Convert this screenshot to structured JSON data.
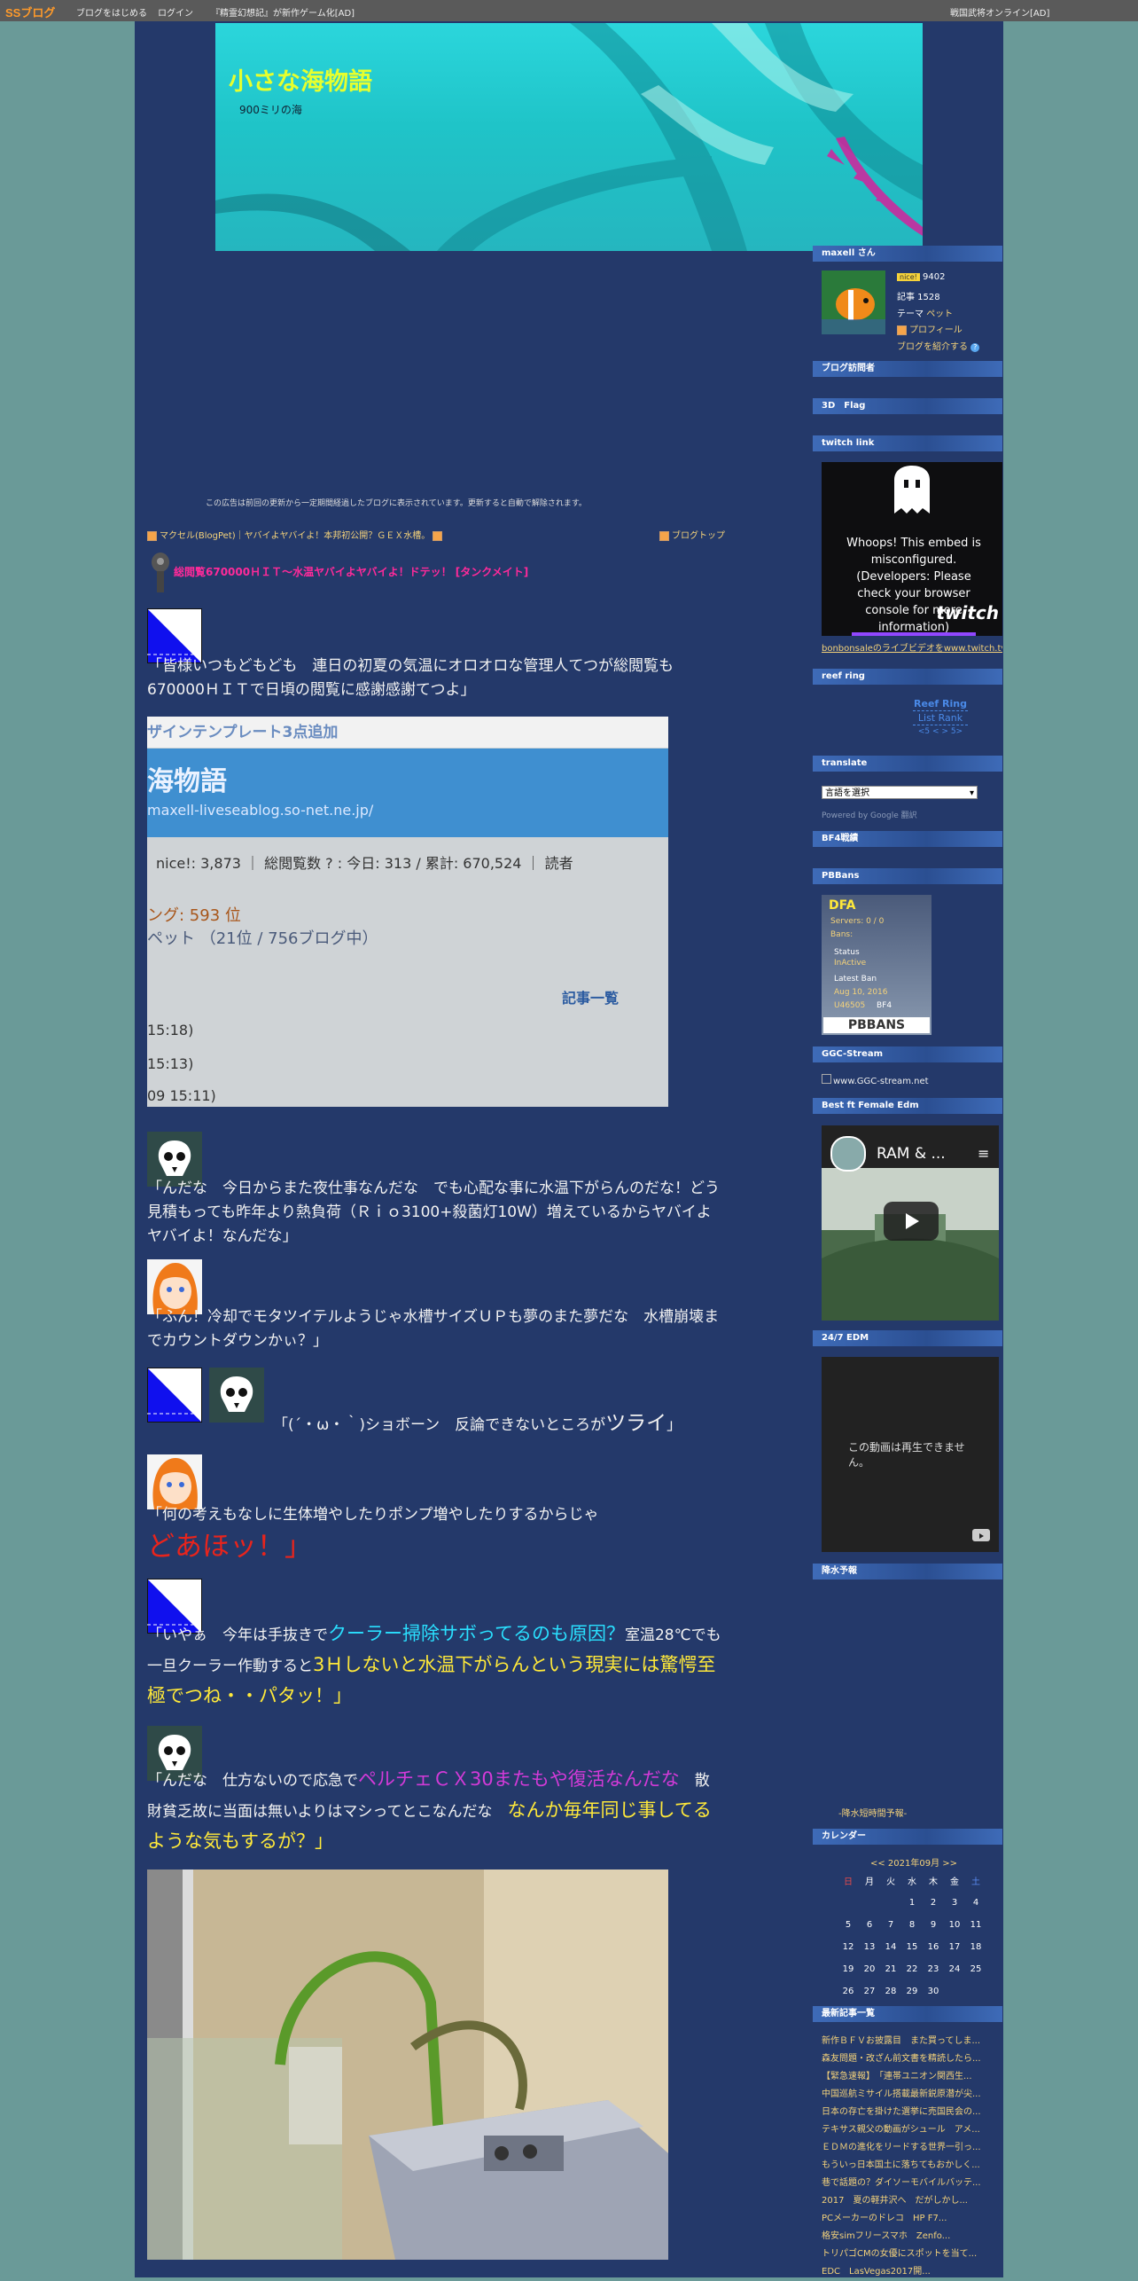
{
  "topbar": {
    "logo": "SSブログ",
    "start_blog": "ブログをはじめる",
    "login": "ログイン",
    "ad_left": "『精霊幻想記』が新作ゲーム化[AD]",
    "ad_right": "戦国武将オンライン[AD]"
  },
  "header": {
    "title": "小さな海物語",
    "subtitle": "900ミリの海"
  },
  "ad_notice": "この広告は前回の更新から一定期間経過したブログに表示されています。更新すると自動で解除されます。",
  "nav": {
    "prev": "マクセル(BlogPet)｜ヤバイよヤバイよ！本邦初公開？ＧＥＸ水槽。",
    "top": "ブログトップ"
  },
  "post": {
    "title": "総閲覧670000ＨＩＴ～水温ヤバイよヤバイよ！ドテッ！ [タンクメイト]",
    "p1": "「皆様いつもどもども　連日の初夏の気温にオロオロな管理人てつが総閲覧も670000ＨＩＴで日頃の閲覧に感謝感謝てつよ」",
    "shot": {
      "banner": "ザインテンプレート3点追加",
      "blog_title": "海物語",
      "url": "maxell-liveseablog.so-net.ne.jp/",
      "stats": "nice!: 3,873 ｜ 総閲覧数 ? : 今日: 313 / 累計: 670,524 ｜ 読者",
      "rank": "ング: 593 位",
      "pet": "ペット （21位 / 756ブログ中）",
      "link": "記事一覧",
      "t1": "15:18)",
      "t2": "15:13)",
      "t3": "09 15:11)"
    },
    "p2": "「んだな　今日からまた夜仕事なんだな　でも心配な事に水温下がらんのだな！どう見積もっても昨年より熱負荷（Ｒｉｏ3100+殺菌灯10W）増えているからヤバイよヤバイよ！なんだな」",
    "p3": "「ふん！冷却でモタツイテルようじゃ水槽サイズＵＰも夢のまた夢だな　水槽崩壊までカウントダウンかぃ？」",
    "p4a": "「(´・ω・｀)ショボーン　反論できないところが",
    "p4b": "ツライ",
    "p4c": "」",
    "p5a": "「何の考えもなしに生体増やしたりポンプ増やしたりするからじゃ",
    "p5b": "どあほッ！」",
    "p6a": "「いやぁ　今年は手抜きで",
    "p6b": "クーラー掃除サボってるのも原因？",
    "p6c": "室温28℃でも一旦クーラー作動すると",
    "p6d": "3Ｈしないと水温下がらんという現実には驚愕至極でつね・・パタッ！」",
    "p7a": "「んだな　仕方ないので応急で",
    "p7b": "ペルチェＣＸ30またもや復活なんだな",
    "p7c": "　散財貧乏故に当面は無いよりはマシってとこなんだな　",
    "p7d": "なんか毎年同じ事してるような気もするが？」"
  },
  "sidebar": {
    "user_head": "maxell さん",
    "nice_badge": "nice!",
    "nice": "9402",
    "articles": "記事 1528",
    "theme_label": "テーマ",
    "theme": "ペット",
    "profile": "プロフィール",
    "introduce": "ブログを紹介する",
    "visitors": "ブログ訪問者",
    "flag": "3D　Flag",
    "twitch_head": "twitch link",
    "twitch_msg": "Whoops! This embed is misconfigured. (Developers: Please check your browser console for more information)",
    "twitch_logo": "twitch",
    "twitch_link": "bonbonsaleのライブビデオをwww.twitch.tv",
    "reef_head": "reef ring",
    "reef1": "Reef Ring",
    "reef2": "List Rank",
    "reef3": "<5 < > 5>",
    "translate_head": "translate",
    "translate_select": "言語を選択",
    "powered": "Powered by Google 翻訳",
    "bf4": "BF4戦績",
    "pbb_head": "PBBans",
    "pbb": {
      "name": "DFA",
      "servers": "Servers: 0 / 0",
      "bans": "Bans:",
      "status_label": "Status",
      "status": "InActive",
      "latest_label": "Latest Ban",
      "latest": "Aug 10, 2016",
      "id": "U46505",
      "game": "BF4",
      "logo": "PBBANS"
    },
    "ggc_head": "GGC-Stream",
    "ggc": "www.GGC-stream.net",
    "edm_head": "Best ft Female Edm",
    "video_title": "RAM & ...",
    "edm247_head": "24/7 EDM",
    "unavailable": "この動画は再生できません。",
    "rain_head": "降水予報",
    "rain_link": "-降水短時間予報-",
    "cal_head": "カレンダー",
    "cal_nav": "<< 2021年09月 >>",
    "cal_days": [
      "日",
      "月",
      "火",
      "水",
      "木",
      "金",
      "土"
    ],
    "cal_rows": [
      [
        "",
        "",
        "",
        "1",
        "2",
        "3",
        "4"
      ],
      [
        "5",
        "6",
        "7",
        "8",
        "9",
        "10",
        "11"
      ],
      [
        "12",
        "13",
        "14",
        "15",
        "16",
        "17",
        "18"
      ],
      [
        "19",
        "20",
        "21",
        "22",
        "23",
        "24",
        "25"
      ],
      [
        "26",
        "27",
        "28",
        "29",
        "30",
        "",
        ""
      ]
    ],
    "recent_head": "最新記事一覧",
    "recent": [
      "新作ＢＦＶお披露目　また買ってしま...",
      "森友問題・改ざん前文書を精読したら...",
      "【緊急速報】　「連帯ユニオン関西生...",
      "中国巡航ミサイル搭載最新鋭原潜が尖...",
      "日本の存亡を掛けた選挙に売国民会の...",
      "テキサス親父の動画がシュール　アメ...",
      "ＥＤＭの進化をリードする世界一引っ...",
      "もういっ日本国土に落ちてもおかしく...",
      "巷で話題の？ダイソーモバイルバッテ...",
      "2017　夏の軽井沢へ　だがしかし...",
      "PCメーカーのドレコ　HP F7...",
      "格安simフリースマホ　Zenfo...",
      "トリパゴCMの女優にスポットを当て...",
      "EDC　LasVegas2017開..."
    ]
  },
  "colors": {
    "page_bg": "#6a9a98",
    "content_bg": "#24396a",
    "title": "#e6ff2e",
    "post_title": "#ff2a9a",
    "sidebar_head": "#3e6bb8"
  }
}
